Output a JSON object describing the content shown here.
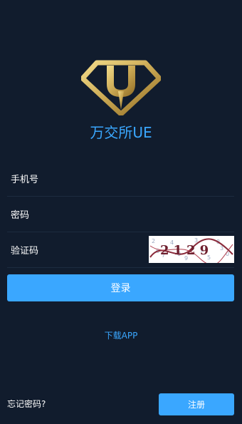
{
  "brand": {
    "name": "万交所UE",
    "color": "#3aa7ff",
    "logo_color": "#c9a752"
  },
  "form": {
    "phone_label": "手机号",
    "password_label": "密码",
    "captcha_label": "验证码",
    "captcha_text": "2129"
  },
  "actions": {
    "login_label": "登录",
    "download_label": "下载APP",
    "forgot_label": "忘记密码?",
    "register_label": "注册"
  },
  "colors": {
    "background": "#111c2d",
    "accent": "#3aa7ff",
    "divider": "#1d2b3f"
  }
}
